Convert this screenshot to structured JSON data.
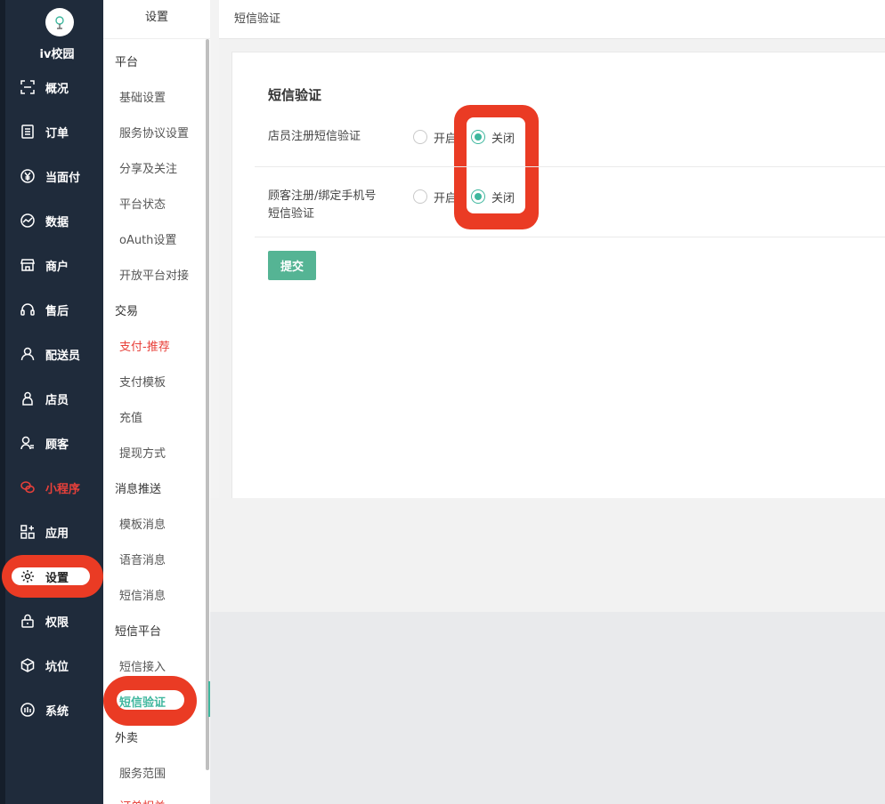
{
  "brand": {
    "name": "iv校园"
  },
  "nav": {
    "items": [
      {
        "label": "概况",
        "icon": "scan-icon"
      },
      {
        "label": "订单",
        "icon": "list-icon"
      },
      {
        "label": "当面付",
        "icon": "yen-icon"
      },
      {
        "label": "数据",
        "icon": "chart-icon"
      },
      {
        "label": "商户",
        "icon": "store-icon"
      },
      {
        "label": "售后",
        "icon": "headset-icon"
      },
      {
        "label": "配送员",
        "icon": "user-icon"
      },
      {
        "label": "店员",
        "icon": "person-icon"
      },
      {
        "label": "顾客",
        "icon": "customer-icon"
      },
      {
        "label": "小程序",
        "icon": "wechat-icon"
      },
      {
        "label": "应用",
        "icon": "apps-icon"
      },
      {
        "label": "设置",
        "icon": "gear-icon"
      },
      {
        "label": "权限",
        "icon": "lock-icon"
      },
      {
        "label": "坑位",
        "icon": "cube-icon"
      },
      {
        "label": "系统",
        "icon": "system-icon"
      }
    ]
  },
  "submenu": {
    "title": "设置",
    "groups": [
      {
        "label": "平台",
        "items": [
          "基础设置",
          "服务协议设置",
          "分享及关注",
          "平台状态",
          "oAuth设置",
          "开放平台对接"
        ]
      },
      {
        "label": "交易",
        "items": [
          "支付-推荐",
          "支付模板",
          "充值",
          "提现方式"
        ]
      },
      {
        "label": "消息推送",
        "items": [
          "模板消息",
          "语音消息",
          "短信消息"
        ]
      },
      {
        "label": "短信平台",
        "items": [
          "短信接入",
          "短信验证"
        ]
      },
      {
        "label": "外卖",
        "items": [
          "服务范围",
          "订单相关"
        ]
      }
    ]
  },
  "header": {
    "breadcrumb": "短信验证"
  },
  "form": {
    "section_title": "短信验证",
    "rows": [
      {
        "label_line1": "店员注册短信验证",
        "label_line2": "",
        "option_on": "开启",
        "option_off": "关闭",
        "selected": "关闭"
      },
      {
        "label_line1": "顾客注册/绑定手机号",
        "label_line2": "短信验证",
        "option_on": "开启",
        "option_off": "关闭",
        "selected": "关闭"
      }
    ],
    "submit_label": "提交"
  },
  "colors": {
    "accent": "#3fb79e",
    "highlight": "#ea3b24",
    "nav_bg": "#1f2b3b"
  }
}
